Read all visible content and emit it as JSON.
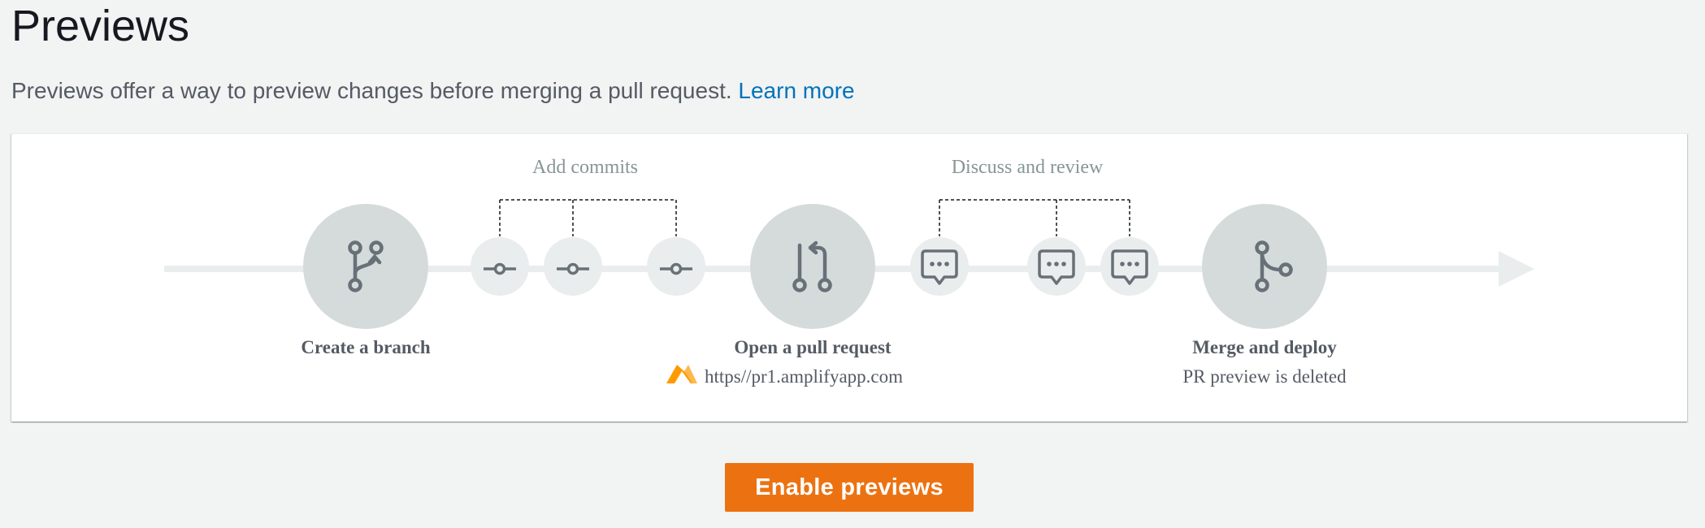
{
  "page": {
    "title": "Previews",
    "description": "Previews offer a way to preview changes before merging a pull request.",
    "learn_more_label": "Learn more"
  },
  "diagram": {
    "group_labels": {
      "add_commits": "Add commits",
      "discuss_and_review": "Discuss and review"
    },
    "steps": {
      "create_branch": {
        "title": "Create a branch",
        "icon": "git-branch-icon"
      },
      "open_pull_request": {
        "title": "Open a pull request",
        "subtitle": "https//pr1.amplifyapp.com",
        "icon": "git-pull-request-icon",
        "subtitle_icon": "amplify-logo-icon"
      },
      "merge_and_deploy": {
        "title": "Merge and deploy",
        "subtitle": "PR preview is deleted",
        "icon": "git-merge-icon"
      }
    },
    "commit_icon": "git-commit-icon",
    "comment_icon": "comment-icon",
    "colors": {
      "track": "#eaeded",
      "circle": "#d5dbdb",
      "small_circle": "#eaeded",
      "icon": "#687078",
      "label": "#545b64",
      "group_label": "#879596",
      "amplify": "#f90"
    }
  },
  "actions": {
    "enable_previews_label": "Enable previews",
    "primary_color": "#ec7211"
  }
}
